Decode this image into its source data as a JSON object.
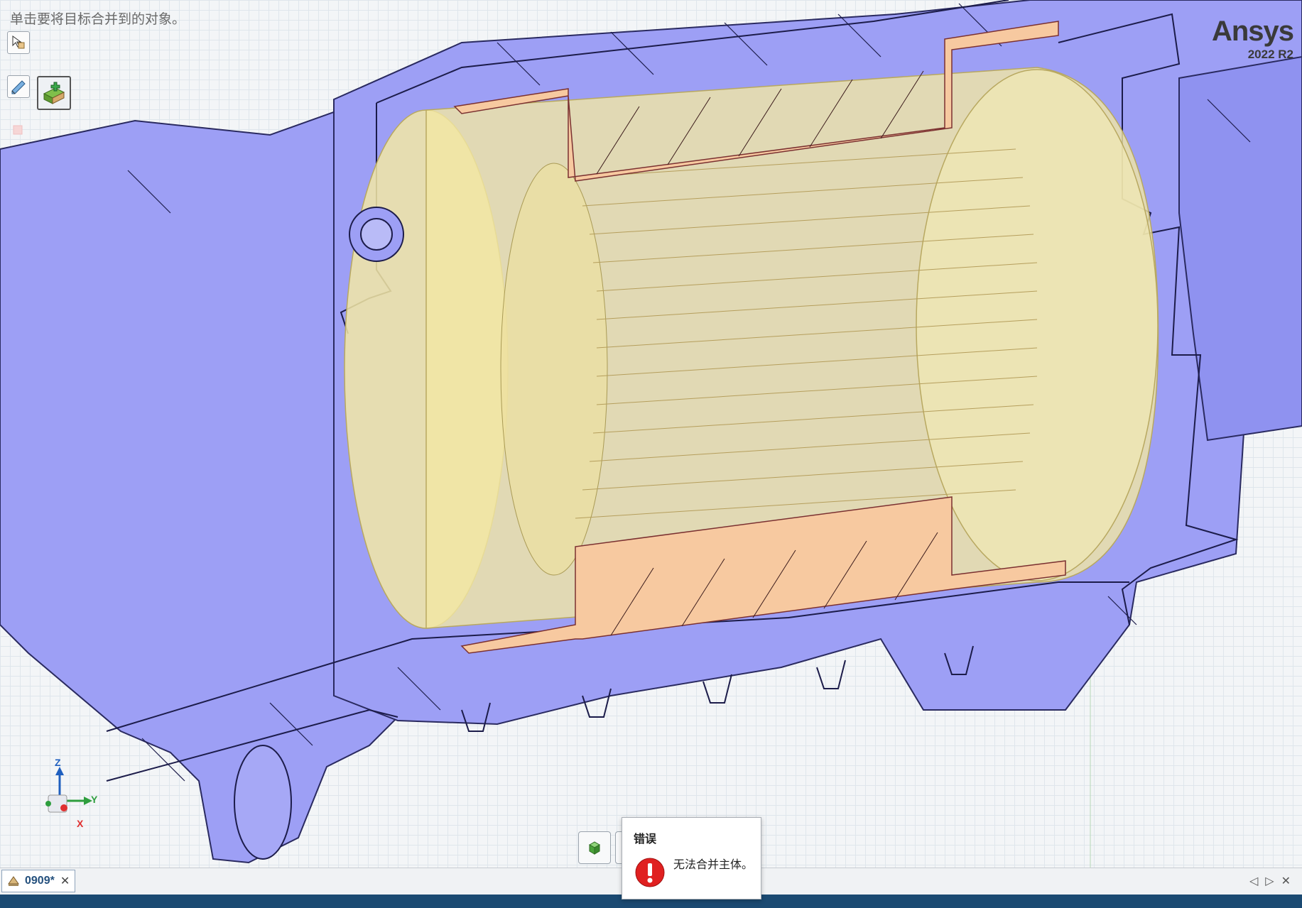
{
  "viewport": {
    "hint": "单击要将目标合并到的对象。",
    "tools": [
      {
        "icon": "select-body-icon"
      },
      {
        "icon": "pen-tool-icon"
      },
      {
        "icon": "combine-merge-icon"
      },
      {
        "icon": "faded-box-icon"
      }
    ],
    "logo": {
      "name": "Ansys",
      "version": "2022 R2"
    },
    "triad": {
      "z": "Z",
      "y": "Y",
      "x": "X"
    },
    "mini_button_icon": "green-cube-icon"
  },
  "error_popup": {
    "title": "错误",
    "message": "无法合并主体。",
    "icon": "error-exclamation-icon"
  },
  "tabs": [
    {
      "label": "0909*",
      "icon": "design-doc-icon",
      "close": "✕"
    }
  ],
  "tab_nav": {
    "prev": "◁",
    "next": "▷",
    "close": "✕"
  },
  "colors": {
    "housing": "#9d9ff5",
    "housing_edge": "#1c1c4a",
    "stator": "#f3e7a4",
    "copper_section": "#f7c9a0",
    "status_bar": "#1b4a72"
  }
}
